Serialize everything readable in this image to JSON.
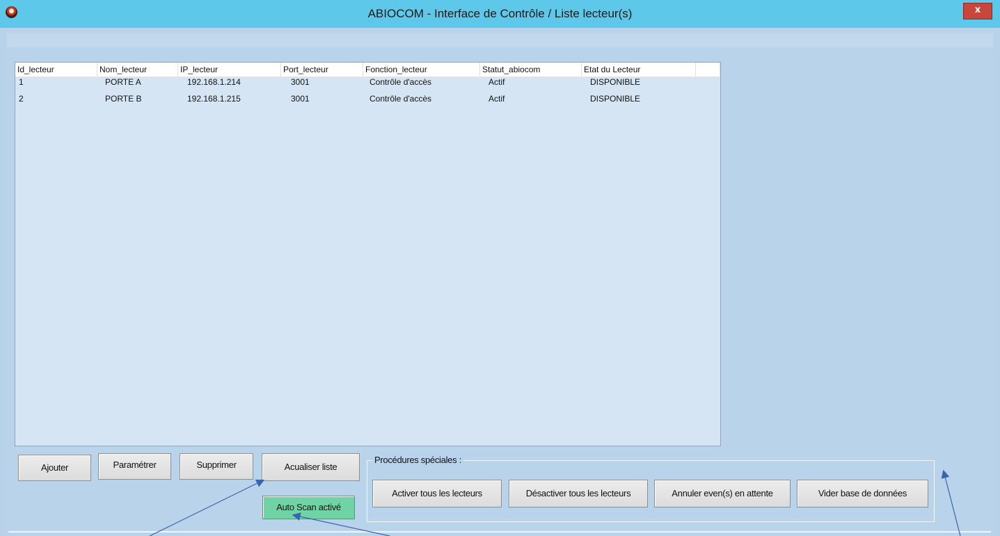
{
  "window": {
    "title": "ABIOCOM - Interface de Contrôle / Liste lecteur(s)",
    "close_glyph": "x",
    "icon": "app-logo-icon"
  },
  "table": {
    "columns": [
      "Id_lecteur",
      "Nom_lecteur",
      "IP_lecteur",
      "Port_lecteur",
      "Fonction_lecteur",
      "Statut_abiocom",
      "Etat du Lecteur"
    ],
    "rows": [
      [
        "1",
        "PORTE A",
        "192.168.1.214",
        "3001",
        "Contrôle d'accès",
        "Actif",
        "DISPONIBLE"
      ],
      [
        "2",
        "PORTE B",
        "192.168.1.215",
        "3001",
        "Contrôle d'accès",
        "Actif",
        "DISPONIBLE"
      ]
    ]
  },
  "buttons": {
    "add": "Ajouter",
    "settings": "Paramétrer",
    "delete": "Supprimer",
    "refresh": "Acualiser liste",
    "autoscan": "Auto Scan activé"
  },
  "special": {
    "label": "Procédures spéciales :",
    "activate_all": "Activer tous les lecteurs",
    "deactivate_all": "Désactiver tous les lecteurs",
    "cancel_events": "Annuler even(s) en attente",
    "clear_db": "Vider base de données"
  },
  "colors": {
    "titlebar": "#5ec8ea",
    "window_bg": "#b9d3ea",
    "list_bg": "#d6e5f4",
    "autoscan_bg": "#6fd3a6",
    "close_bg": "#c9463d",
    "annotation_arrow": "#3a63b0"
  }
}
